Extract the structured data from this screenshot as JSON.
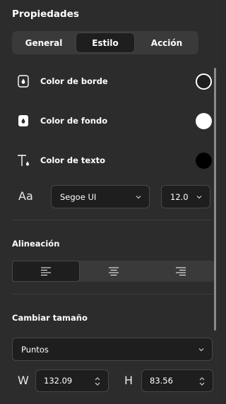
{
  "panel": {
    "title": "Propiedades"
  },
  "tabs": [
    {
      "label": "General",
      "active": false
    },
    {
      "label": "Estilo",
      "active": true
    },
    {
      "label": "Acción",
      "active": false
    }
  ],
  "style": {
    "border_color": {
      "label": "Color de borde",
      "value": "#1e1e1e"
    },
    "fill_color": {
      "label": "Color de fondo",
      "value": "#ffffff"
    },
    "text_color": {
      "label": "Color de texto",
      "value": "#000000"
    },
    "font": {
      "icon_label": "Aa",
      "family": "Segoe UI",
      "size": "12.0"
    }
  },
  "alignment": {
    "title": "Alineación",
    "options": [
      "align-left",
      "align-center",
      "align-right"
    ],
    "selected": "align-left"
  },
  "resize": {
    "title": "Cambiar tamaño",
    "unit": "Puntos",
    "width_label": "W",
    "width_value": "132.09",
    "height_label": "H",
    "height_value": "83.56"
  }
}
